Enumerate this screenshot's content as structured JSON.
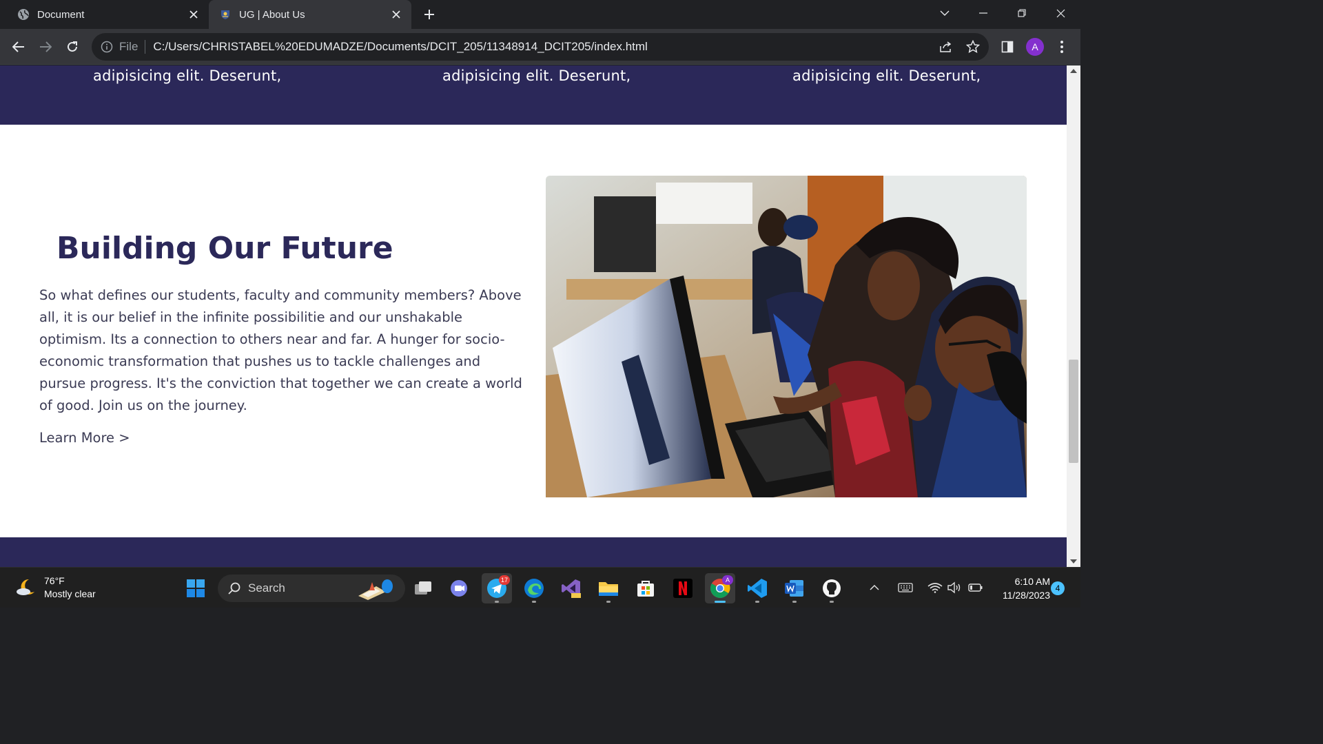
{
  "browser": {
    "tabs": [
      {
        "title": "Document",
        "active": false,
        "icon": "globe-icon"
      },
      {
        "title": "UG | About Us",
        "active": true,
        "icon": "ug-crest-icon"
      }
    ],
    "address": {
      "scheme_label": "File",
      "url": "C:/Users/CHRISTABEL%20EDUMADZE/Documents/DCIT_205/11348914_DCIT205/index.html"
    },
    "profile_initial": "A"
  },
  "page": {
    "top_band": {
      "columns": [
        "adipisicing elit. Deserunt,",
        "adipisicing elit. Deserunt,",
        "adipisicing elit. Deserunt,"
      ]
    },
    "section": {
      "heading": "Building Our Future",
      "paragraph": "So what defines our students, faculty and community members? Above all, it is our belief in the infinite possibilitie and our unshakable optimism. Its a connection to others near and far. A hunger for socio-economic transformation that pushes us to tackle challenges and pursue progress. It's the conviction that together we can create a world of good. Join us on the journey.",
      "link": "Learn More >"
    },
    "colors": {
      "band": "#2b2859",
      "heading": "#2b2859",
      "body_text": "#3b3b54"
    }
  },
  "taskbar": {
    "weather": {
      "temp": "76°F",
      "condition": "Mostly clear"
    },
    "search_label": "Search",
    "telegram_badge": "17",
    "chrome_profile_initial": "A",
    "clock": {
      "time": "6:10 AM",
      "date": "11/28/2023"
    },
    "notification_count": "4",
    "apps": [
      "start",
      "telegram",
      "edge",
      "visual-studio-preview",
      "file-explorer",
      "microsoft-store",
      "netflix",
      "chrome",
      "vscode",
      "word",
      "github-desktop"
    ]
  }
}
